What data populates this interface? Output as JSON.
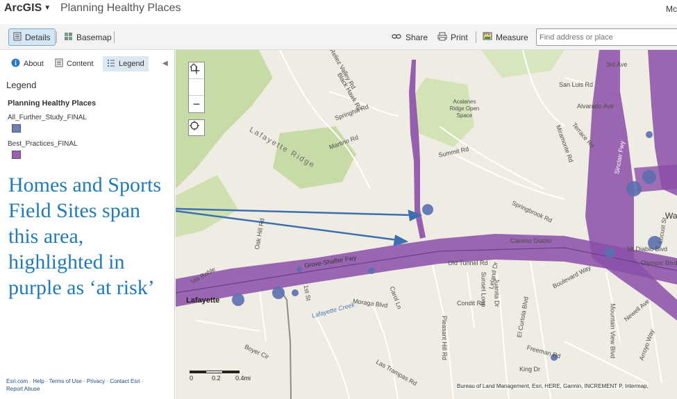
{
  "header": {
    "brand": "ArcGIS",
    "app_title": "Planning Healthy Places",
    "user": "Mc"
  },
  "toolbar": {
    "details": "Details",
    "basemap": "Basemap",
    "share": "Share",
    "print": "Print",
    "measure": "Measure",
    "search_placeholder": "Find address or place"
  },
  "panel": {
    "tabs": {
      "about": "About",
      "content": "Content",
      "legend": "Legend"
    },
    "legend_heading": "Legend",
    "legend_title": "Planning Healthy Places",
    "layers": [
      {
        "name": "All_Further_Study_FINAL",
        "color": "#6b80b4"
      },
      {
        "name": "Best_Practices_FINAL",
        "color": "#9b5fb5"
      }
    ],
    "note": "Homes and Sports Field Sites span this area, highlighted in purple as ‘at risk’",
    "note_color": "#1f7ab8",
    "footer": {
      "esri": "Esri.com",
      "help": "Help",
      "terms": "Terms of Use",
      "privacy": "Privacy",
      "contact": "Contact Esri",
      "report": "Report Abuse"
    }
  },
  "map": {
    "zoom_in": "+",
    "zoom_out": "−",
    "scale_labels": [
      "0",
      "0.2",
      "0.4mi"
    ],
    "attribution": "Bureau of Land Management, Esri, HERE, Garmin, INCREMENT P, Intermap,",
    "place_label": "Lafayette",
    "road_labels": {
      "grove_shafter": "Grove-Shafter Fwy",
      "old_tunnel": "Old Tunnel Rd",
      "camino_diablo": "Camino Diablo",
      "moraga": "Moraga Blvd",
      "pleasant_hill": "Pleasant Hill Rd",
      "springbrook": "Springbrook Rd",
      "summit": "Summit Rd",
      "acalanes": "Acalanes Ridge Open Space",
      "lafayette_ridge": "Lafayette Ridge",
      "san_luis": "San Luis Rd",
      "alvarado": "Alvarado Ave",
      "third_ave": "3rd Ave",
      "mt_diablo": "Mt Diablo Blvd",
      "olympic": "Olympic Blvd",
      "boulevard_way": "Boulevard Way",
      "freeman": "Freeman Rd",
      "king": "King Dr",
      "condit": "Condit Rd",
      "newell": "Newell Ave",
      "mountain_view": "Mountain View Blvd",
      "las_trampas": "Las Trampas Rd",
      "boyer": "Boyer Cir",
      "martino": "Martino Rd",
      "springhill": "Springhill Rd",
      "black_hawk": "Black Hawk Rd",
      "oak_hill": "Oak Hill Rd",
      "first_st": "1st St",
      "carol": "Carol Ln",
      "terrace": "Terrace Rd",
      "miramonte": "Miramonte Rd",
      "walnut": "Wa",
      "sinclair": "Sinclair Fwy",
      "locust": "Locust St",
      "arroyo": "Arroyo Way",
      "juanita": "Juanita Dr",
      "el_curtola": "El Curtola Blvd",
      "sunset_loop": "Sunset Loop",
      "leland": "Leland Dr",
      "via_roble": "Via Roble",
      "happy_valley": "Happy Valley Rd",
      "lafayette_creek": "Lafayette Creek",
      "reliez_valley": "Reliez Valley Rd"
    }
  }
}
